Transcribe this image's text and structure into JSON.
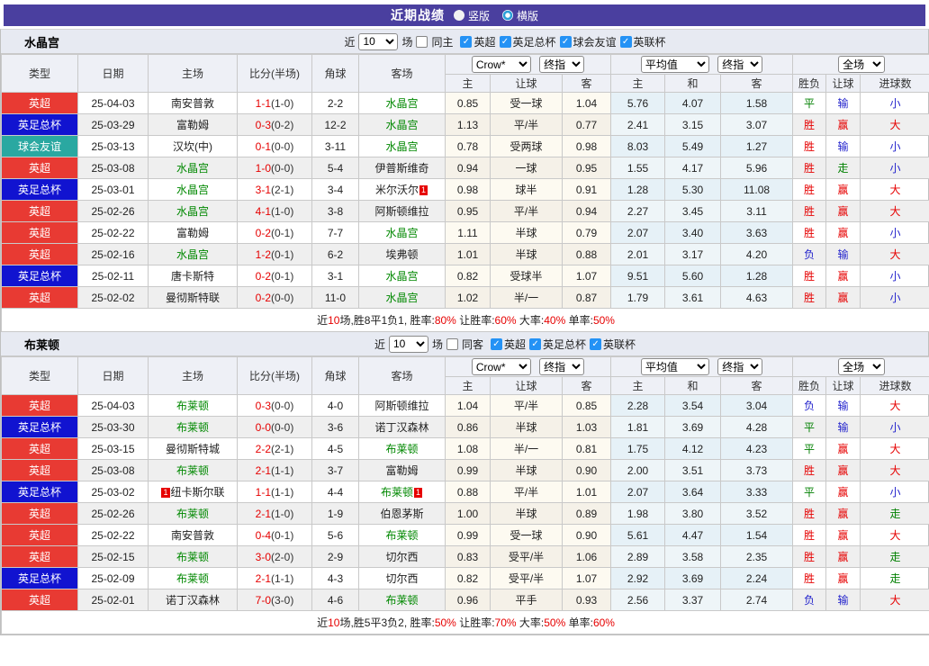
{
  "title_bar": {
    "title": "近期战绩",
    "radios": [
      {
        "label": "竖版",
        "selected": true
      },
      {
        "label": "横版",
        "selected": false
      }
    ]
  },
  "labels": {
    "near": "近",
    "games": "场"
  },
  "colors": {
    "accent_purple": "#4a3f9f",
    "epl_red": "#e83a33",
    "facup_blue": "#1113d0",
    "friendly_teal": "#2aa8a1",
    "team_green": "#008800",
    "win_red": "#e60000",
    "draw_green": "#008000",
    "lose_blue": "#2323cc",
    "checkbox_blue": "#2492f5",
    "crow_col_bg": "#fdfaf1",
    "avg_col_bg": "#e6f1f7"
  },
  "table_header": {
    "static": [
      "类型",
      "日期",
      "主场",
      "比分(半场)",
      "角球",
      "客场"
    ],
    "sub": [
      "主",
      "让球",
      "客",
      "主",
      "和",
      "客",
      "胜负",
      "让球",
      "进球数"
    ],
    "selects": {
      "crow": "Crow*",
      "final": "终指",
      "avg": "平均值",
      "final2": "终指",
      "full": "全场"
    }
  },
  "sections": [
    {
      "team": "水晶宫",
      "filter_count": "10",
      "same_side": "同主",
      "leagues": [
        "英超",
        "英足总杯",
        "球会友谊",
        "英联杯"
      ],
      "rows": [
        {
          "league": "epl",
          "type": "英超",
          "date": "25-04-03",
          "home": {
            "name": "南安普敦"
          },
          "ft": "1-1",
          "ht": "(1-0)",
          "corner": "2-2",
          "away": {
            "name": "水晶宫",
            "team": true
          },
          "crow": [
            "0.85",
            "受一球",
            "1.04"
          ],
          "avg": [
            "5.76",
            "4.07",
            "1.58"
          ],
          "res": [
            "平",
            "g"
          ],
          "hc": [
            "输",
            "b"
          ],
          "goal": [
            "小",
            "b"
          ]
        },
        {
          "league": "facup",
          "type": "英足总杯",
          "date": "25-03-29",
          "home": {
            "name": "富勒姆"
          },
          "ft": "0-3",
          "ht": "(0-2)",
          "corner": "12-2",
          "away": {
            "name": "水晶宫",
            "team": true
          },
          "crow": [
            "1.13",
            "平/半",
            "0.77"
          ],
          "avg": [
            "2.41",
            "3.15",
            "3.07"
          ],
          "res": [
            "胜",
            "r"
          ],
          "hc": [
            "赢",
            "r"
          ],
          "goal": [
            "大",
            "r"
          ]
        },
        {
          "league": "friendly",
          "type": "球会友谊",
          "date": "25-03-13",
          "home": {
            "name": "汉坎(中)"
          },
          "ft": "0-1",
          "ht": "(0-0)",
          "corner": "3-11",
          "away": {
            "name": "水晶宫",
            "team": true
          },
          "crow": [
            "0.78",
            "受两球",
            "0.98"
          ],
          "avg": [
            "8.03",
            "5.49",
            "1.27"
          ],
          "res": [
            "胜",
            "r"
          ],
          "hc": [
            "输",
            "b"
          ],
          "goal": [
            "小",
            "b"
          ]
        },
        {
          "league": "epl",
          "type": "英超",
          "date": "25-03-08",
          "home": {
            "name": "水晶宫",
            "team": true
          },
          "ft": "1-0",
          "ht": "(0-0)",
          "corner": "5-4",
          "away": {
            "name": "伊普斯维奇"
          },
          "crow": [
            "0.94",
            "一球",
            "0.95"
          ],
          "avg": [
            "1.55",
            "4.17",
            "5.96"
          ],
          "res": [
            "胜",
            "r"
          ],
          "hc": [
            "走",
            "g"
          ],
          "goal": [
            "小",
            "b"
          ]
        },
        {
          "league": "facup",
          "type": "英足总杯",
          "date": "25-03-01",
          "home": {
            "name": "水晶宫",
            "team": true
          },
          "ft": "3-1",
          "ht": "(2-1)",
          "corner": "3-4",
          "away": {
            "name": "米尔沃尔",
            "b2": "1"
          },
          "crow": [
            "0.98",
            "球半",
            "0.91"
          ],
          "avg": [
            "1.28",
            "5.30",
            "11.08"
          ],
          "res": [
            "胜",
            "r"
          ],
          "hc": [
            "赢",
            "r"
          ],
          "goal": [
            "大",
            "r"
          ]
        },
        {
          "league": "epl",
          "type": "英超",
          "date": "25-02-26",
          "home": {
            "name": "水晶宫",
            "team": true
          },
          "ft": "4-1",
          "ht": "(1-0)",
          "corner": "3-8",
          "away": {
            "name": "阿斯顿维拉"
          },
          "crow": [
            "0.95",
            "平/半",
            "0.94"
          ],
          "avg": [
            "2.27",
            "3.45",
            "3.11"
          ],
          "res": [
            "胜",
            "r"
          ],
          "hc": [
            "赢",
            "r"
          ],
          "goal": [
            "大",
            "r"
          ]
        },
        {
          "league": "epl",
          "type": "英超",
          "date": "25-02-22",
          "home": {
            "name": "富勒姆"
          },
          "ft": "0-2",
          "ht": "(0-1)",
          "corner": "7-7",
          "away": {
            "name": "水晶宫",
            "team": true
          },
          "crow": [
            "1.11",
            "半球",
            "0.79"
          ],
          "avg": [
            "2.07",
            "3.40",
            "3.63"
          ],
          "res": [
            "胜",
            "r"
          ],
          "hc": [
            "赢",
            "r"
          ],
          "goal": [
            "小",
            "b"
          ]
        },
        {
          "league": "epl",
          "type": "英超",
          "date": "25-02-16",
          "home": {
            "name": "水晶宫",
            "team": true
          },
          "ft": "1-2",
          "ht": "(0-1)",
          "corner": "6-2",
          "away": {
            "name": "埃弗顿"
          },
          "crow": [
            "1.01",
            "半球",
            "0.88"
          ],
          "avg": [
            "2.01",
            "3.17",
            "4.20"
          ],
          "res": [
            "负",
            "b"
          ],
          "hc": [
            "输",
            "b"
          ],
          "goal": [
            "大",
            "r"
          ]
        },
        {
          "league": "facup",
          "type": "英足总杯",
          "date": "25-02-11",
          "home": {
            "name": "唐卡斯特"
          },
          "ft": "0-2",
          "ht": "(0-1)",
          "corner": "3-1",
          "away": {
            "name": "水晶宫",
            "team": true
          },
          "crow": [
            "0.82",
            "受球半",
            "1.07"
          ],
          "avg": [
            "9.51",
            "5.60",
            "1.28"
          ],
          "res": [
            "胜",
            "r"
          ],
          "hc": [
            "赢",
            "r"
          ],
          "goal": [
            "小",
            "b"
          ]
        },
        {
          "league": "epl",
          "type": "英超",
          "date": "25-02-02",
          "home": {
            "name": "曼彻斯特联"
          },
          "ft": "0-2",
          "ht": "(0-0)",
          "corner": "11-0",
          "away": {
            "name": "水晶宫",
            "team": true
          },
          "crow": [
            "1.02",
            "半/一",
            "0.87"
          ],
          "avg": [
            "1.79",
            "3.61",
            "4.63"
          ],
          "res": [
            "胜",
            "r"
          ],
          "hc": [
            "赢",
            "r"
          ],
          "goal": [
            "小",
            "b"
          ]
        }
      ],
      "summary": [
        [
          "近",
          "k"
        ],
        [
          "10",
          "r"
        ],
        [
          "场,胜8平1负1, 胜率:",
          "k"
        ],
        [
          "80%",
          "r"
        ],
        [
          " 让胜率:",
          "k"
        ],
        [
          "60%",
          "r"
        ],
        [
          " 大率:",
          "k"
        ],
        [
          "40%",
          "r"
        ],
        [
          " 单率:",
          "k"
        ],
        [
          "50%",
          "r"
        ]
      ]
    },
    {
      "team": "布莱顿",
      "filter_count": "10",
      "same_side": "同客",
      "leagues": [
        "英超",
        "英足总杯",
        "英联杯"
      ],
      "rows": [
        {
          "league": "epl",
          "type": "英超",
          "date": "25-04-03",
          "home": {
            "name": "布莱顿",
            "team": true
          },
          "ft": "0-3",
          "ht": "(0-0)",
          "corner": "4-0",
          "away": {
            "name": "阿斯顿维拉"
          },
          "crow": [
            "1.04",
            "平/半",
            "0.85"
          ],
          "avg": [
            "2.28",
            "3.54",
            "3.04"
          ],
          "res": [
            "负",
            "b"
          ],
          "hc": [
            "输",
            "b"
          ],
          "goal": [
            "大",
            "r"
          ]
        },
        {
          "league": "facup",
          "type": "英足总杯",
          "date": "25-03-30",
          "home": {
            "name": "布莱顿",
            "team": true
          },
          "ft": "0-0",
          "ht": "(0-0)",
          "corner": "3-6",
          "away": {
            "name": "诺丁汉森林"
          },
          "crow": [
            "0.86",
            "半球",
            "1.03"
          ],
          "avg": [
            "1.81",
            "3.69",
            "4.28"
          ],
          "res": [
            "平",
            "g"
          ],
          "hc": [
            "输",
            "b"
          ],
          "goal": [
            "小",
            "b"
          ]
        },
        {
          "league": "epl",
          "type": "英超",
          "date": "25-03-15",
          "home": {
            "name": "曼彻斯特城"
          },
          "ft": "2-2",
          "ht": "(2-1)",
          "corner": "4-5",
          "away": {
            "name": "布莱顿",
            "team": true
          },
          "crow": [
            "1.08",
            "半/一",
            "0.81"
          ],
          "avg": [
            "1.75",
            "4.12",
            "4.23"
          ],
          "res": [
            "平",
            "g"
          ],
          "hc": [
            "赢",
            "r"
          ],
          "goal": [
            "大",
            "r"
          ]
        },
        {
          "league": "epl",
          "type": "英超",
          "date": "25-03-08",
          "home": {
            "name": "布莱顿",
            "team": true
          },
          "ft": "2-1",
          "ht": "(1-1)",
          "corner": "3-7",
          "away": {
            "name": "富勒姆"
          },
          "crow": [
            "0.99",
            "半球",
            "0.90"
          ],
          "avg": [
            "2.00",
            "3.51",
            "3.73"
          ],
          "res": [
            "胜",
            "r"
          ],
          "hc": [
            "赢",
            "r"
          ],
          "goal": [
            "大",
            "r"
          ]
        },
        {
          "league": "facup",
          "type": "英足总杯",
          "date": "25-03-02",
          "home": {
            "name": "纽卡斯尔联",
            "b1": "1"
          },
          "ft": "1-1",
          "ht": "(1-1)",
          "corner": "4-4",
          "away": {
            "name": "布莱顿",
            "team": true,
            "b2": "1"
          },
          "crow": [
            "0.88",
            "平/半",
            "1.01"
          ],
          "avg": [
            "2.07",
            "3.64",
            "3.33"
          ],
          "res": [
            "平",
            "g"
          ],
          "hc": [
            "赢",
            "r"
          ],
          "goal": [
            "小",
            "b"
          ]
        },
        {
          "league": "epl",
          "type": "英超",
          "date": "25-02-26",
          "home": {
            "name": "布莱顿",
            "team": true
          },
          "ft": "2-1",
          "ht": "(1-0)",
          "corner": "1-9",
          "away": {
            "name": "伯恩茅斯"
          },
          "crow": [
            "1.00",
            "半球",
            "0.89"
          ],
          "avg": [
            "1.98",
            "3.80",
            "3.52"
          ],
          "res": [
            "胜",
            "r"
          ],
          "hc": [
            "赢",
            "r"
          ],
          "goal": [
            "走",
            "g"
          ]
        },
        {
          "league": "epl",
          "type": "英超",
          "date": "25-02-22",
          "home": {
            "name": "南安普敦"
          },
          "ft": "0-4",
          "ht": "(0-1)",
          "corner": "5-6",
          "away": {
            "name": "布莱顿",
            "team": true
          },
          "crow": [
            "0.99",
            "受一球",
            "0.90"
          ],
          "avg": [
            "5.61",
            "4.47",
            "1.54"
          ],
          "res": [
            "胜",
            "r"
          ],
          "hc": [
            "赢",
            "r"
          ],
          "goal": [
            "大",
            "r"
          ]
        },
        {
          "league": "epl",
          "type": "英超",
          "date": "25-02-15",
          "home": {
            "name": "布莱顿",
            "team": true
          },
          "ft": "3-0",
          "ht": "(2-0)",
          "corner": "2-9",
          "away": {
            "name": "切尔西"
          },
          "crow": [
            "0.83",
            "受平/半",
            "1.06"
          ],
          "avg": [
            "2.89",
            "3.58",
            "2.35"
          ],
          "res": [
            "胜",
            "r"
          ],
          "hc": [
            "赢",
            "r"
          ],
          "goal": [
            "走",
            "g"
          ]
        },
        {
          "league": "facup",
          "type": "英足总杯",
          "date": "25-02-09",
          "home": {
            "name": "布莱顿",
            "team": true
          },
          "ft": "2-1",
          "ht": "(1-1)",
          "corner": "4-3",
          "away": {
            "name": "切尔西"
          },
          "crow": [
            "0.82",
            "受平/半",
            "1.07"
          ],
          "avg": [
            "2.92",
            "3.69",
            "2.24"
          ],
          "res": [
            "胜",
            "r"
          ],
          "hc": [
            "赢",
            "r"
          ],
          "goal": [
            "走",
            "g"
          ]
        },
        {
          "league": "epl",
          "type": "英超",
          "date": "25-02-01",
          "home": {
            "name": "诺丁汉森林"
          },
          "ft": "7-0",
          "ht": "(3-0)",
          "corner": "4-6",
          "away": {
            "name": "布莱顿",
            "team": true
          },
          "crow": [
            "0.96",
            "平手",
            "0.93"
          ],
          "avg": [
            "2.56",
            "3.37",
            "2.74"
          ],
          "res": [
            "负",
            "b"
          ],
          "hc": [
            "输",
            "b"
          ],
          "goal": [
            "大",
            "r"
          ]
        }
      ],
      "summary": [
        [
          "近",
          "k"
        ],
        [
          "10",
          "r"
        ],
        [
          "场,胜5平3负2, 胜率:",
          "k"
        ],
        [
          "50%",
          "r"
        ],
        [
          " 让胜率:",
          "k"
        ],
        [
          "70%",
          "r"
        ],
        [
          " 大率:",
          "k"
        ],
        [
          "50%",
          "r"
        ],
        [
          " 单率:",
          "k"
        ],
        [
          "60%",
          "r"
        ]
      ]
    }
  ]
}
